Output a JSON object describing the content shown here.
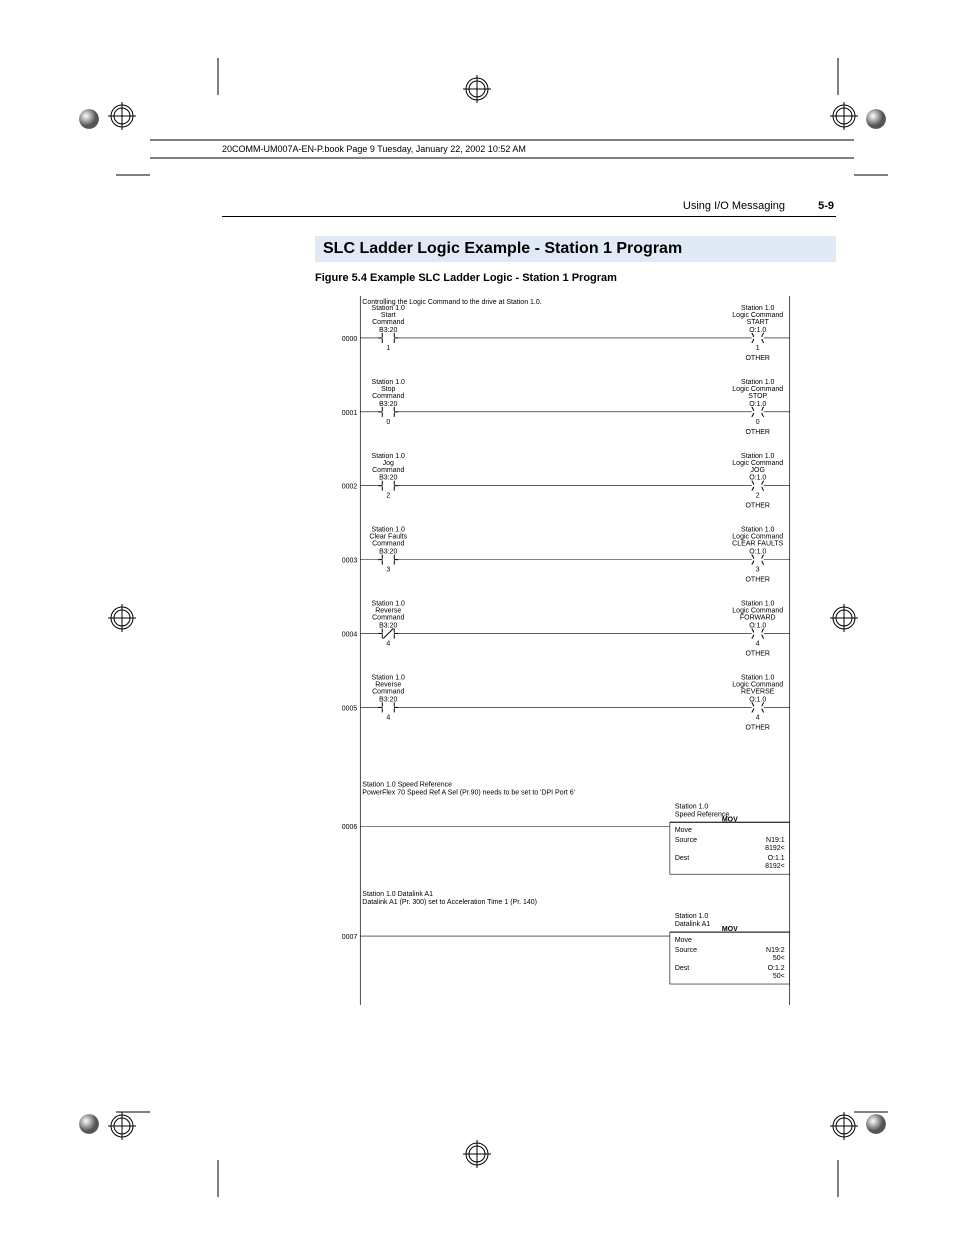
{
  "runhead": "20COMM-UM007A-EN-P.book  Page 9  Tuesday, January 22, 2002  10:52 AM",
  "chapter_header": "Using I/O Messaging",
  "page_number": "5-9",
  "section_title": "SLC Ladder Logic Example - Station 1 Program",
  "figure_caption": "Figure 5.4   Example SLC Ladder Logic - Station 1 Program",
  "main_comment": "Controlling the Logic Command to the drive at Station 1.0.",
  "rungs": [
    {
      "num": "0000",
      "left": {
        "l1": "Station 1.0",
        "l2": "Start",
        "l3": "Command",
        "addr": "B3:20",
        "bit": "1"
      },
      "right": {
        "l1": "Station 1.0",
        "l2": "Logic Command",
        "l3": "START",
        "addr": "O:1.0",
        "bit": "1",
        "other": "OTHER"
      }
    },
    {
      "num": "0001",
      "left": {
        "l1": "Station 1.0",
        "l2": "Stop",
        "l3": "Command",
        "addr": "B3:20",
        "bit": "0"
      },
      "right": {
        "l1": "Station 1.0",
        "l2": "Logic Command",
        "l3": "STOP",
        "addr": "O:1.0",
        "bit": "0",
        "other": "OTHER"
      }
    },
    {
      "num": "0002",
      "left": {
        "l1": "Station 1.0",
        "l2": "Jog",
        "l3": "Command",
        "addr": "B3:20",
        "bit": "2"
      },
      "right": {
        "l1": "Station 1.0",
        "l2": "Logic Command",
        "l3": "JOG",
        "addr": "O:1.0",
        "bit": "2",
        "other": "OTHER"
      }
    },
    {
      "num": "0003",
      "left": {
        "l1": "Station 1.0",
        "l2": "Clear Faults",
        "l3": "Command",
        "addr": "B3:20",
        "bit": "3"
      },
      "right": {
        "l1": "Station 1.0",
        "l2": "Logic Command",
        "l3": "CLEAR FAULTS",
        "addr": "O:1.0",
        "bit": "3",
        "other": "OTHER"
      }
    },
    {
      "num": "0004",
      "left": {
        "l1": "Station 1.0",
        "l2": "Reverse",
        "l3": "Command",
        "addr": "B3:20",
        "bit": "4",
        "slash": true
      },
      "right": {
        "l1": "Station 1.0",
        "l2": "Logic Command",
        "l3": "FORWARD",
        "addr": "O:1.0",
        "bit": "4",
        "other": "OTHER"
      }
    },
    {
      "num": "0005",
      "left": {
        "l1": "Station 1.0",
        "l2": "Reverse",
        "l3": "Command",
        "addr": "B3:20",
        "bit": "4"
      },
      "right": {
        "l1": "Station 1.0",
        "l2": "Logic Command",
        "l3": "REVERSE",
        "addr": "O:1.0",
        "bit": "4",
        "other": "OTHER"
      }
    }
  ],
  "mov_rungs": [
    {
      "num": "0006",
      "comment_l1": "Station 1.0 Speed Reference",
      "comment_l2": "PowerFlex 70 Speed Ref A Sel (Pr.90) needs to be set to 'DPI Port 6'",
      "box_title1": "Station 1.0",
      "box_title2": "Speed Reference",
      "mov": "MOV",
      "move": "Move",
      "src_lbl": "Source",
      "src_val": "N19:1",
      "src_sub": "8192<",
      "dst_lbl": "Dest",
      "dst_val": "O:1.1",
      "dst_sub": "8192<"
    },
    {
      "num": "0007",
      "comment_l1": "Station 1.0 Datalink A1",
      "comment_l2": "Datalink A1 (Pr. 300) set to Acceleration Time 1 (Pr. 140)",
      "box_title1": "Station 1.0",
      "box_title2": "Datalink A1",
      "mov": "MOV",
      "move": "Move",
      "src_lbl": "Source",
      "src_val": "N19:2",
      "src_sub": "50<",
      "dst_lbl": "Dest",
      "dst_val": "O:1.2",
      "dst_sub": "50<"
    }
  ]
}
